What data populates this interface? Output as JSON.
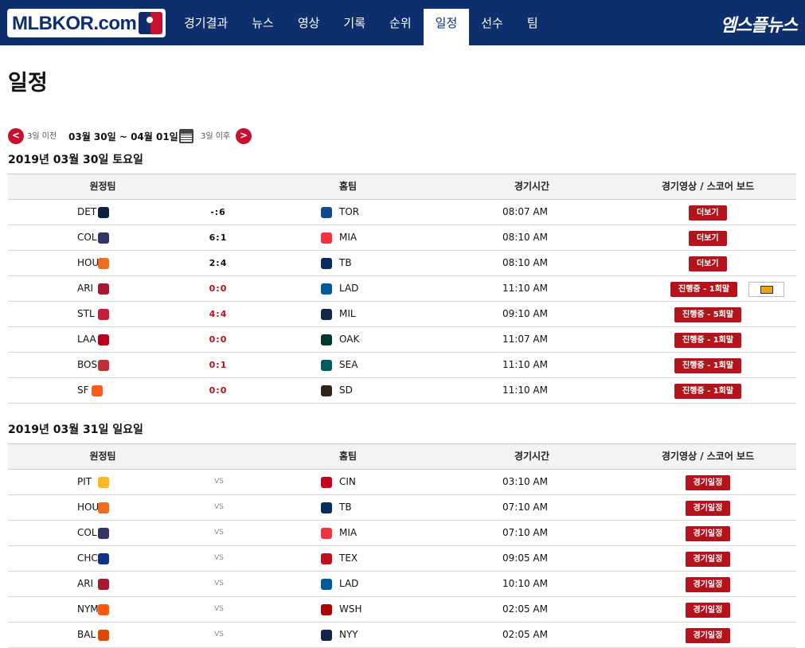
{
  "nav": {
    "logo": "MLBKOR.com",
    "items": [
      "경기결과",
      "뉴스",
      "영상",
      "기록",
      "순위",
      "일정",
      "선수",
      "팀"
    ],
    "active": "일정",
    "brand": "엠스플뉴스"
  },
  "page_title": "일정",
  "datenav": {
    "prev_icon": "<",
    "prev_label": "3일 이전",
    "range": "03월 30일 ~ 04월 01일",
    "next_label": "3일 이후",
    "next_icon": ">"
  },
  "columns": {
    "away": "원정팀",
    "home": "홈팀",
    "time": "경기시간",
    "video": "경기영상 / 스코어 보드"
  },
  "colors": {
    "nav_bg": "#0e2f6e",
    "accent": "#b5121b"
  },
  "days": [
    {
      "title": "2019년 03월 30일 토요일",
      "games": [
        {
          "away": "DET",
          "away_icon": "tigers-logo-icon",
          "score": "-:6",
          "live": false,
          "home": "TOR",
          "home_icon": "bluejays-logo-icon",
          "time": "08:07 AM",
          "action": "더보기",
          "tv": false
        },
        {
          "away": "COL",
          "away_icon": "rockies-logo-icon",
          "score": "6:1",
          "live": false,
          "home": "MIA",
          "home_icon": "marlins-logo-icon",
          "time": "08:10 AM",
          "action": "더보기",
          "tv": false
        },
        {
          "away": "HOU",
          "away_icon": "astros-logo-icon",
          "score": "2:4",
          "live": false,
          "home": "TB",
          "home_icon": "rays-logo-icon",
          "time": "08:10 AM",
          "action": "더보기",
          "tv": false
        },
        {
          "away": "ARI",
          "away_icon": "dbacks-logo-icon",
          "score": "0:0",
          "live": true,
          "home": "LAD",
          "home_icon": "dodgers-logo-icon",
          "time": "11:10 AM",
          "action": "진행중 - 1회말",
          "tv": true
        },
        {
          "away": "STL",
          "away_icon": "cardinals-logo-icon",
          "score": "4:4",
          "live": true,
          "home": "MIL",
          "home_icon": "brewers-logo-icon",
          "time": "09:10 AM",
          "action": "진행중 - 5회말",
          "tv": false
        },
        {
          "away": "LAA",
          "away_icon": "angels-logo-icon",
          "score": "0:0",
          "live": true,
          "home": "OAK",
          "home_icon": "athletics-logo-icon",
          "time": "11:07 AM",
          "action": "진행중 - 1회말",
          "tv": false
        },
        {
          "away": "BOS",
          "away_icon": "redsox-logo-icon",
          "score": "0:1",
          "live": true,
          "home": "SEA",
          "home_icon": "mariners-logo-icon",
          "time": "11:10 AM",
          "action": "진행중 - 1회말",
          "tv": false
        },
        {
          "away": "SF",
          "away_icon": "giants-logo-icon",
          "score": "0:0",
          "live": true,
          "home": "SD",
          "home_icon": "padres-logo-icon",
          "time": "11:10 AM",
          "action": "진행중 - 1회말",
          "tv": false
        }
      ]
    },
    {
      "title": "2019년 03월 31일 일요일",
      "games": [
        {
          "away": "PIT",
          "away_icon": "pirates-logo-icon",
          "score": "VS",
          "vs": true,
          "home": "CIN",
          "home_icon": "reds-logo-icon",
          "time": "03:10 AM",
          "action": "경기일정"
        },
        {
          "away": "HOU",
          "away_icon": "astros-logo-icon",
          "score": "VS",
          "vs": true,
          "home": "TB",
          "home_icon": "rays-logo-icon",
          "time": "07:10 AM",
          "action": "경기일정"
        },
        {
          "away": "COL",
          "away_icon": "rockies-logo-icon",
          "score": "VS",
          "vs": true,
          "home": "MIA",
          "home_icon": "marlins-logo-icon",
          "time": "07:10 AM",
          "action": "경기일정"
        },
        {
          "away": "CHC",
          "away_icon": "cubs-logo-icon",
          "score": "VS",
          "vs": true,
          "home": "TEX",
          "home_icon": "rangers-logo-icon",
          "time": "09:05 AM",
          "action": "경기일정"
        },
        {
          "away": "ARI",
          "away_icon": "dbacks-logo-icon",
          "score": "VS",
          "vs": true,
          "home": "LAD",
          "home_icon": "dodgers-logo-icon",
          "time": "10:10 AM",
          "action": "경기일정"
        },
        {
          "away": "NYM",
          "away_icon": "mets-logo-icon",
          "score": "VS",
          "vs": true,
          "home": "WSH",
          "home_icon": "nationals-logo-icon",
          "time": "02:05 AM",
          "action": "경기일정"
        },
        {
          "away": "BAL",
          "away_icon": "orioles-logo-icon",
          "score": "VS",
          "vs": true,
          "home": "NYY",
          "home_icon": "yankees-logo-icon",
          "time": "02:05 AM",
          "action": "경기일정"
        }
      ]
    }
  ]
}
